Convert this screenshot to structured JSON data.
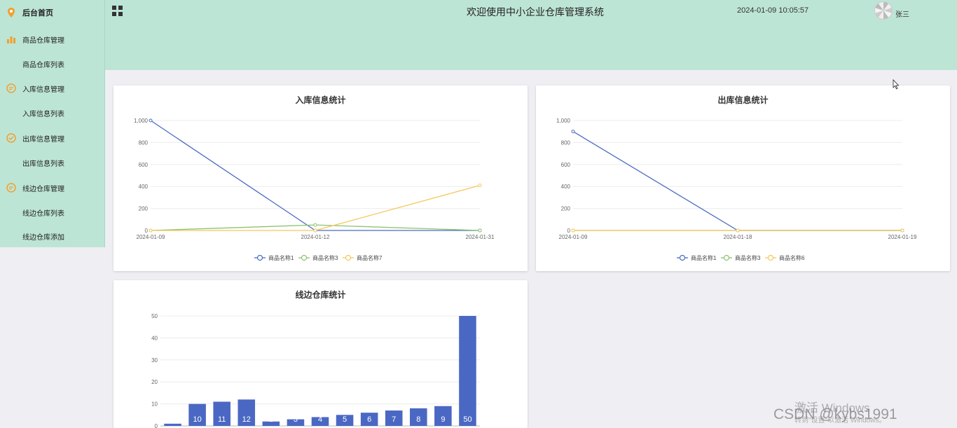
{
  "sidebar": {
    "items": [
      {
        "label": "后台首页",
        "type": "top",
        "icon": "location-pin-icon"
      },
      {
        "label": "商品仓库管理",
        "type": "group",
        "icon": "bar-chart-icon"
      },
      {
        "label": "商品仓库列表",
        "type": "sub"
      },
      {
        "label": "入库信息管理",
        "type": "group",
        "icon": "message-icon"
      },
      {
        "label": "入库信息列表",
        "type": "sub"
      },
      {
        "label": "出库信息管理",
        "type": "group",
        "icon": "check-circle-icon"
      },
      {
        "label": "出库信息列表",
        "type": "sub"
      },
      {
        "label": "线边仓库管理",
        "type": "group",
        "icon": "message-icon"
      },
      {
        "label": "线边仓库列表",
        "type": "sub"
      },
      {
        "label": "线边仓库添加",
        "type": "sub"
      }
    ]
  },
  "header": {
    "title": "欢迎使用中小企业仓库管理系统",
    "datetime": "2024-01-09 10:05:57",
    "username": "张三"
  },
  "colors": {
    "accent_green": "#bde5d6",
    "series_blue": "#4a6cc4",
    "series_green": "#8cc46c",
    "series_yellow": "#f5c85a",
    "bar_blue": "#4a68c3"
  },
  "watermark": {
    "line1": "激活 Windows",
    "line2": "转到\"设置\"以激活 Windows。",
    "csdn": "CSDN @kybs1991"
  },
  "chart_data": [
    {
      "type": "line",
      "title": "入库信息统计",
      "x": [
        "2024-01-09",
        "2024-01-12",
        "2024-01-31"
      ],
      "ylim": [
        0,
        1000
      ],
      "yticks": [
        "0",
        "200",
        "400",
        "600",
        "800",
        "1,000"
      ],
      "grid": true,
      "legend": "bottom",
      "series": [
        {
          "name": "商品名称1",
          "values": [
            1000,
            0,
            0
          ]
        },
        {
          "name": "商品名称3",
          "values": [
            0,
            50,
            0
          ]
        },
        {
          "name": "商品名称7",
          "values": [
            0,
            0,
            410
          ]
        }
      ]
    },
    {
      "type": "line",
      "title": "出库信息统计",
      "x": [
        "2024-01-09",
        "2024-01-18",
        "2024-01-19"
      ],
      "ylim": [
        0,
        1000
      ],
      "yticks": [
        "0",
        "200",
        "400",
        "600",
        "800",
        "1,000"
      ],
      "grid": true,
      "legend": "bottom",
      "series": [
        {
          "name": "商品名称1",
          "values": [
            900,
            0,
            0
          ]
        },
        {
          "name": "商品名称3",
          "values": [
            0,
            0,
            0
          ]
        },
        {
          "name": "商品名称6",
          "values": [
            0,
            0,
            0
          ]
        }
      ]
    },
    {
      "type": "bar",
      "title": "线边仓库统计",
      "values": [
        1,
        10,
        11,
        12,
        2,
        3,
        4,
        5,
        6,
        7,
        8,
        9,
        50
      ],
      "data_labels": [
        "1",
        "10",
        "11",
        "12",
        "2",
        "3",
        "4",
        "5",
        "6",
        "7",
        "8",
        "9",
        "50"
      ],
      "ylim": [
        0,
        50
      ],
      "yticks": [
        "0",
        "10",
        "20",
        "30",
        "40",
        "50"
      ],
      "grid": true
    }
  ]
}
